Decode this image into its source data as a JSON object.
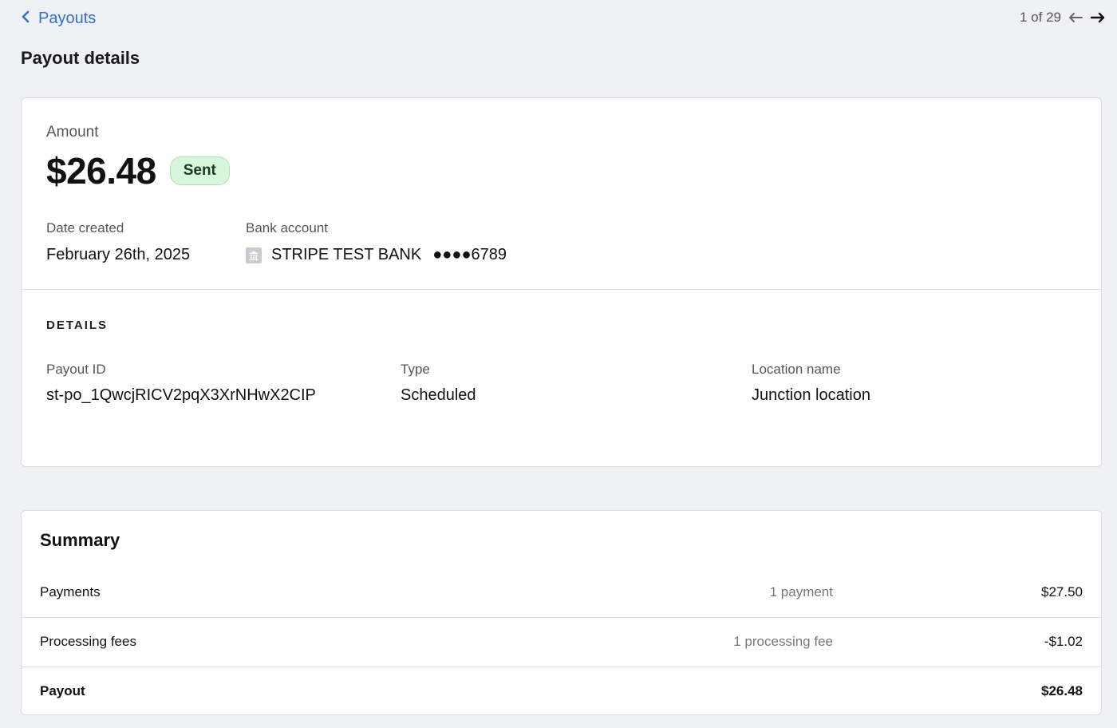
{
  "nav": {
    "back_label": "Payouts",
    "pager_text": "1 of 29"
  },
  "page": {
    "title": "Payout details"
  },
  "payout": {
    "amount_label": "Amount",
    "amount": "$26.48",
    "status": "Sent",
    "date_label": "Date created",
    "date": "February 26th, 2025",
    "bank_label": "Bank account",
    "bank_name": "STRIPE TEST BANK",
    "bank_mask": "●●●●6789"
  },
  "details": {
    "heading": "DETAILS",
    "payout_id_label": "Payout ID",
    "payout_id": "st-po_1QwcjRICV2pqX3XrNHwX2CIP",
    "type_label": "Type",
    "type": "Scheduled",
    "location_label": "Location name",
    "location": "Junction location"
  },
  "summary": {
    "title": "Summary",
    "rows": [
      {
        "label": "Payments",
        "count": "1 payment",
        "amount": "$27.50"
      },
      {
        "label": "Processing fees",
        "count": "1 processing fee",
        "amount": "-$1.02"
      },
      {
        "label": "Payout",
        "count": "",
        "amount": "$26.48"
      }
    ]
  },
  "colors": {
    "link": "#2f6fd6",
    "badge_bg": "#d8f6dc",
    "badge_border": "#a8e2b1",
    "page_bg": "#f0f1f5"
  },
  "icons": {
    "back": "chevron-left-icon",
    "prev": "arrow-left-icon",
    "next": "arrow-right-icon",
    "bank": "bank-icon"
  }
}
